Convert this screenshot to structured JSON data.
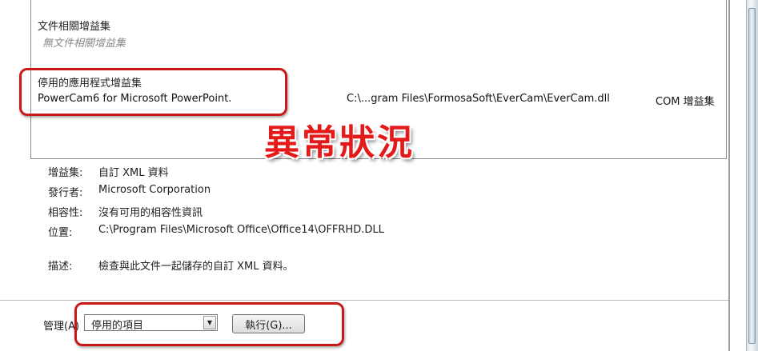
{
  "addins": {
    "document_group_title": "文件相關增益集",
    "document_group_empty": "無文件相關增益集",
    "disabled_group_title": "停用的應用程式增益集",
    "disabled_item": {
      "name": "PowerCam6 for Microsoft PowerPoint.",
      "location": "C:\\...gram Files\\FormosaSoft\\EverCam\\EverCam.dll",
      "type": "COM 增益集"
    }
  },
  "annotation": {
    "text": "異常狀況",
    "color": "#e41a1a"
  },
  "details": {
    "addin_label": "增益集:",
    "addin_value": "自訂 XML 資料",
    "publisher_label": "發行者:",
    "publisher_value": "Microsoft Corporation",
    "compat_label": "相容性:",
    "compat_value": "沒有可用的相容性資訊",
    "location_label": "位置:",
    "location_value": "C:\\Program Files\\Microsoft Office\\Office14\\OFFRHD.DLL",
    "description_label": "描述:",
    "description_value": "檢查與此文件一起儲存的自訂 XML 資料。"
  },
  "manage": {
    "label": "管理(A)",
    "selected": "停用的項目",
    "go_button": "執行(G)..."
  }
}
